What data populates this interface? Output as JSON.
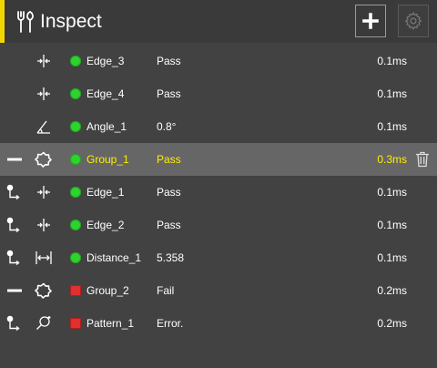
{
  "header": {
    "title": "Inspect",
    "icon": "tools-icon",
    "add_icon": "plus-icon",
    "settings_icon": "gear-icon",
    "accent_color": "#f2d600"
  },
  "rows": [
    {
      "lead": "",
      "tool": "edge-icon",
      "status": "pass",
      "name": "Edge_3",
      "value": "Pass",
      "time": "0.1ms"
    },
    {
      "lead": "",
      "tool": "edge-icon",
      "status": "pass",
      "name": "Edge_4",
      "value": "Pass",
      "time": "0.1ms"
    },
    {
      "lead": "",
      "tool": "angle-icon",
      "status": "pass",
      "name": "Angle_1",
      "value": "0.8°",
      "time": "0.1ms"
    },
    {
      "lead": "collapse-icon",
      "tool": "group-icon",
      "status": "pass",
      "name": "Group_1",
      "value": "Pass",
      "time": "0.3ms",
      "selected": true,
      "delete_icon": "trash-icon"
    },
    {
      "lead": "link-icon",
      "tool": "edge-icon",
      "status": "pass",
      "name": "Edge_1",
      "value": "Pass",
      "time": "0.1ms"
    },
    {
      "lead": "link-icon",
      "tool": "edge-icon",
      "status": "pass",
      "name": "Edge_2",
      "value": "Pass",
      "time": "0.1ms"
    },
    {
      "lead": "link-icon",
      "tool": "distance-icon",
      "status": "pass",
      "name": "Distance_1",
      "value": "5.358",
      "time": "0.1ms"
    },
    {
      "lead": "collapse-icon",
      "tool": "group-icon",
      "status": "fail",
      "name": "Group_2",
      "value": "Fail",
      "time": "0.2ms"
    },
    {
      "lead": "link-icon",
      "tool": "pattern-icon",
      "status": "fail",
      "name": "Pattern_1",
      "value": "Error.",
      "time": "0.2ms"
    }
  ],
  "colors": {
    "pass": "#2fd32f",
    "fail": "#e03030",
    "selected_text": "#ffee00",
    "selected_row": "#666666"
  }
}
